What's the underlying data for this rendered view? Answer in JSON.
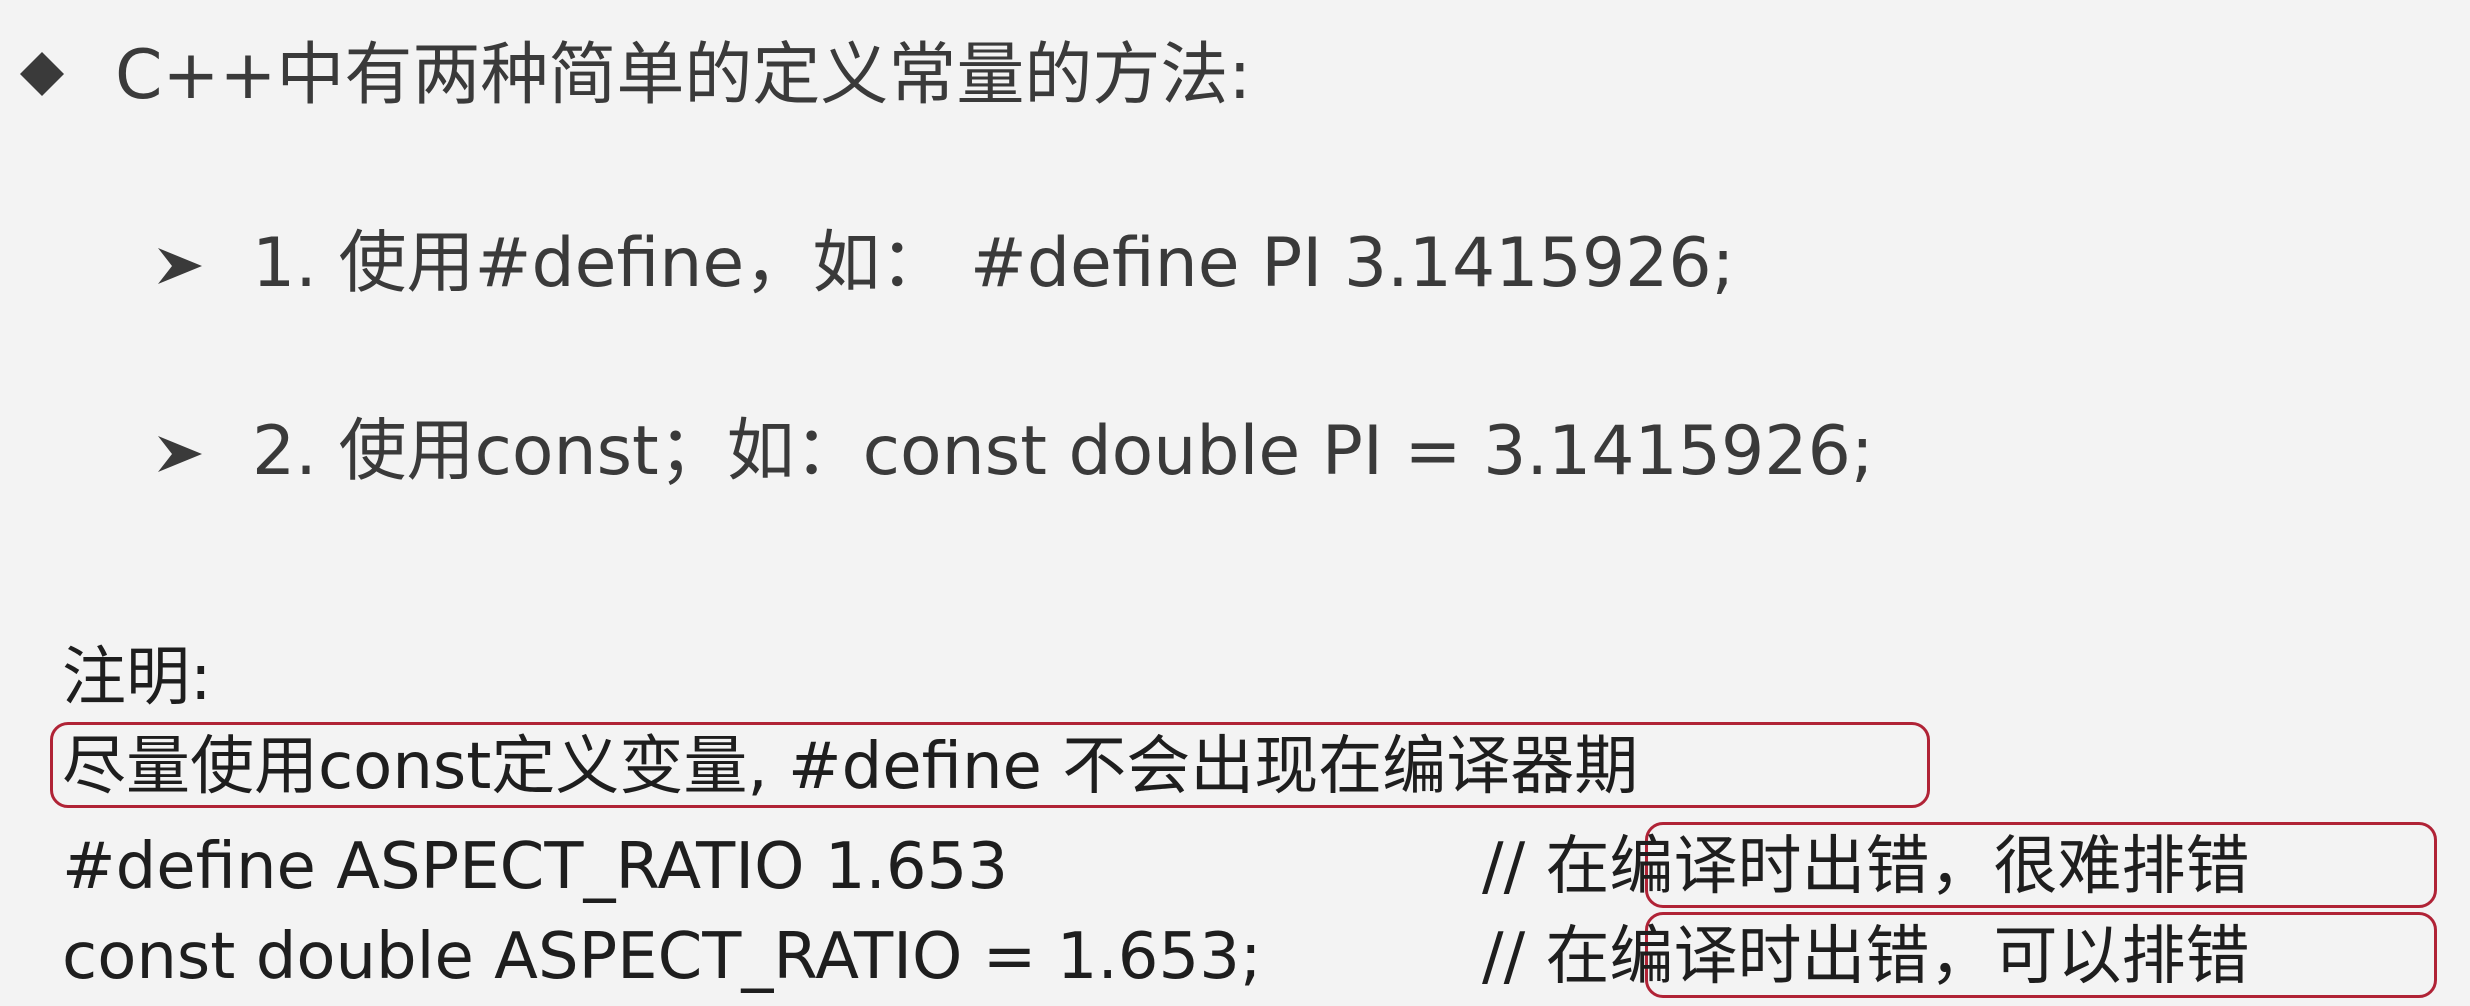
{
  "icons": {
    "main_bullet": "black-diamond-icon",
    "sub_bullet": "arrow-bullet-icon"
  },
  "colors": {
    "background": "#f3f3f3",
    "text": "#3a3a3a",
    "highlight_border": "#b02336"
  },
  "heading": "C++中有两种简单的定义常量的方法:",
  "items": [
    "1. 使用#define，如： #define PI 3.1415926;",
    "2. 使用const；如：const double PI = 3.1415926;"
  ],
  "note": {
    "title": "注明:",
    "highlight": "尽量使用const定义变量, #define 不会出现在编译器期",
    "code_lines": [
      {
        "code": "#define ASPECT_RATIO 1.653",
        "comment": "// 在编译时出错，很难排错"
      },
      {
        "code": "const double ASPECT_RATIO = 1.653;",
        "comment": "// 在编译时出错，可以排错"
      }
    ]
  }
}
